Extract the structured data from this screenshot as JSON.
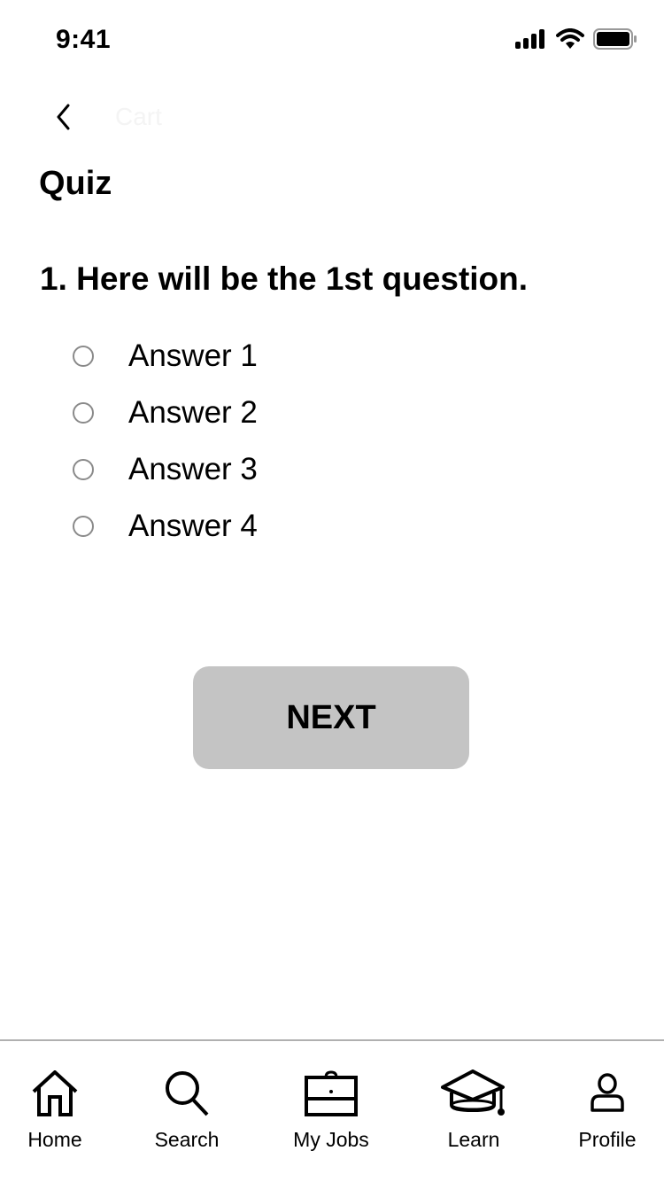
{
  "status_bar": {
    "time": "9:41"
  },
  "nav": {
    "back_icon": "chevron-left-icon",
    "title": "Cart"
  },
  "page": {
    "title": "Quiz"
  },
  "quiz": {
    "question": "1. Here will be the 1st question.",
    "answers": [
      {
        "label": "Answer 1",
        "selected": false
      },
      {
        "label": "Answer 2",
        "selected": false
      },
      {
        "label": "Answer 3",
        "selected": false
      },
      {
        "label": "Answer 4",
        "selected": false
      }
    ],
    "next_label": "NEXT"
  },
  "tab_bar": {
    "items": [
      {
        "label": "Home",
        "icon": "home-icon"
      },
      {
        "label": "Search",
        "icon": "search-icon"
      },
      {
        "label": "My Jobs",
        "icon": "briefcase-icon"
      },
      {
        "label": "Learn",
        "icon": "graduation-cap-icon"
      },
      {
        "label": "Profile",
        "icon": "person-icon"
      }
    ]
  },
  "colors": {
    "button_bg": "#c4c4c4",
    "radio_border": "#8a8a8a",
    "divider": "#b0b0b0"
  }
}
